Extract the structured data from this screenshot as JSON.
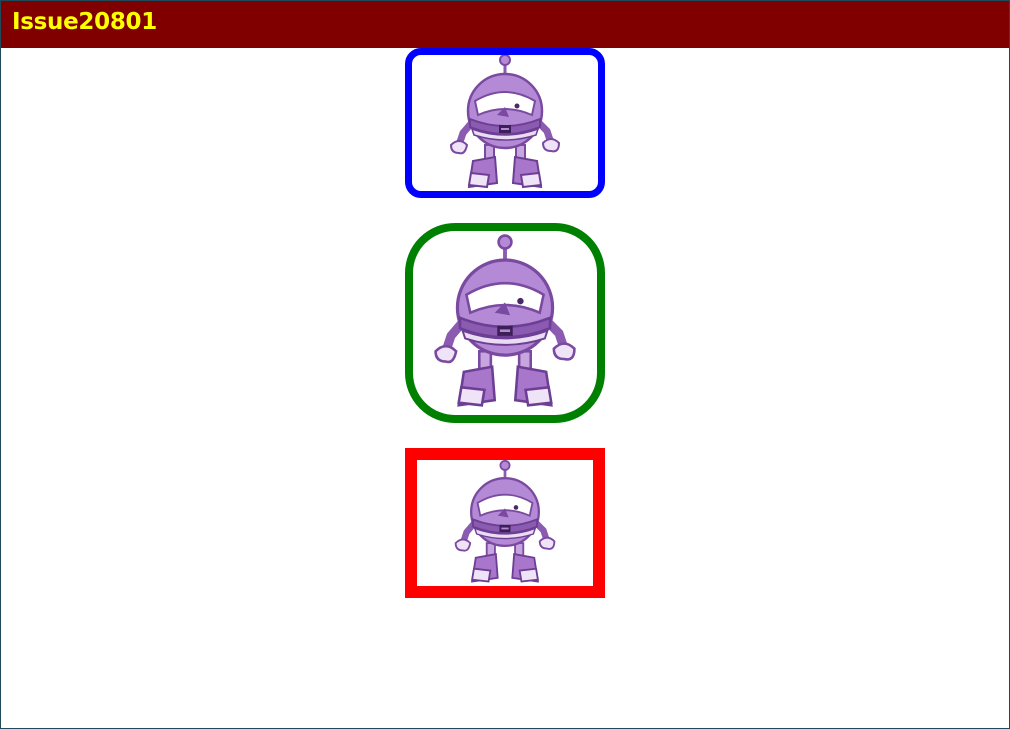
{
  "window": {
    "title": "Issue20801",
    "title_bar_color": "#800000",
    "title_text_color": "#FFFF00"
  },
  "frames": [
    {
      "name": "blue-rounded-frame",
      "border_color": "#0000FF",
      "image": "dotnet-bot-robot"
    },
    {
      "name": "green-rounded-frame",
      "border_color": "#008000",
      "image": "dotnet-bot-robot"
    },
    {
      "name": "red-square-frame",
      "border_color": "#FF0000",
      "image": "dotnet-bot-robot"
    }
  ]
}
